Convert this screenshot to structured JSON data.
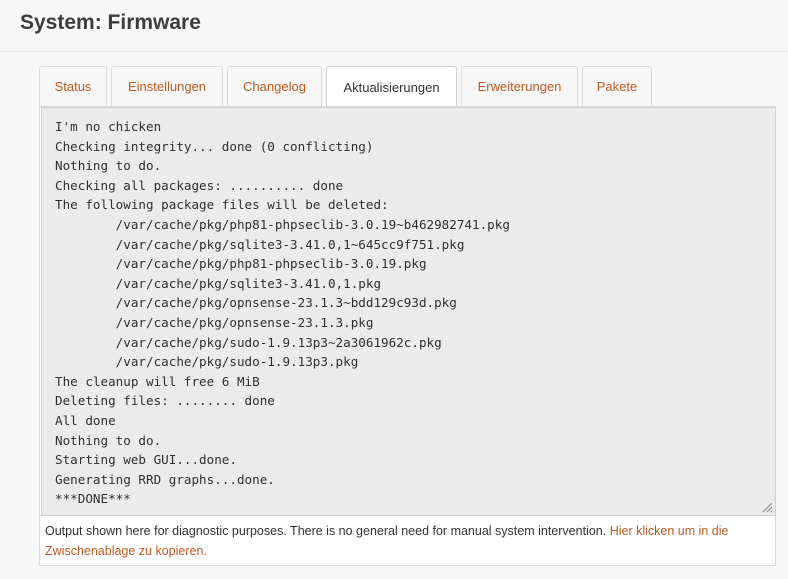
{
  "page": {
    "title": "System: Firmware"
  },
  "tabs": [
    {
      "label": "Status",
      "active": false
    },
    {
      "label": "Einstellungen",
      "active": false
    },
    {
      "label": "Changelog",
      "active": false
    },
    {
      "label": "Aktualisierungen",
      "active": true
    },
    {
      "label": "Erweiterungen",
      "active": false
    },
    {
      "label": "Pakete",
      "active": false
    }
  ],
  "output": {
    "lines": [
      "I'm no chicken",
      "Checking integrity... done (0 conflicting)",
      "Nothing to do.",
      "Checking all packages: .......... done",
      "The following package files will be deleted:",
      "        /var/cache/pkg/php81-phpseclib-3.0.19~b462982741.pkg",
      "        /var/cache/pkg/sqlite3-3.41.0,1~645cc9f751.pkg",
      "        /var/cache/pkg/php81-phpseclib-3.0.19.pkg",
      "        /var/cache/pkg/sqlite3-3.41.0,1.pkg",
      "        /var/cache/pkg/opnsense-23.1.3~bdd129c93d.pkg",
      "        /var/cache/pkg/opnsense-23.1.3.pkg",
      "        /var/cache/pkg/sudo-1.9.13p3~2a3061962c.pkg",
      "        /var/cache/pkg/sudo-1.9.13p3.pkg",
      "The cleanup will free 6 MiB",
      "Deleting files: ........ done",
      "All done",
      "Nothing to do.",
      "Starting web GUI...done.",
      "Generating RRD graphs...done.",
      "***DONE***"
    ]
  },
  "footer": {
    "note": "Output shown here for diagnostic purposes. There is no general need for manual system intervention. ",
    "copy_link": "Hier klicken um in die Zwischenablage zu kopieren."
  },
  "colors": {
    "accent": "#c0591e",
    "output_bg": "#ebebeb"
  }
}
